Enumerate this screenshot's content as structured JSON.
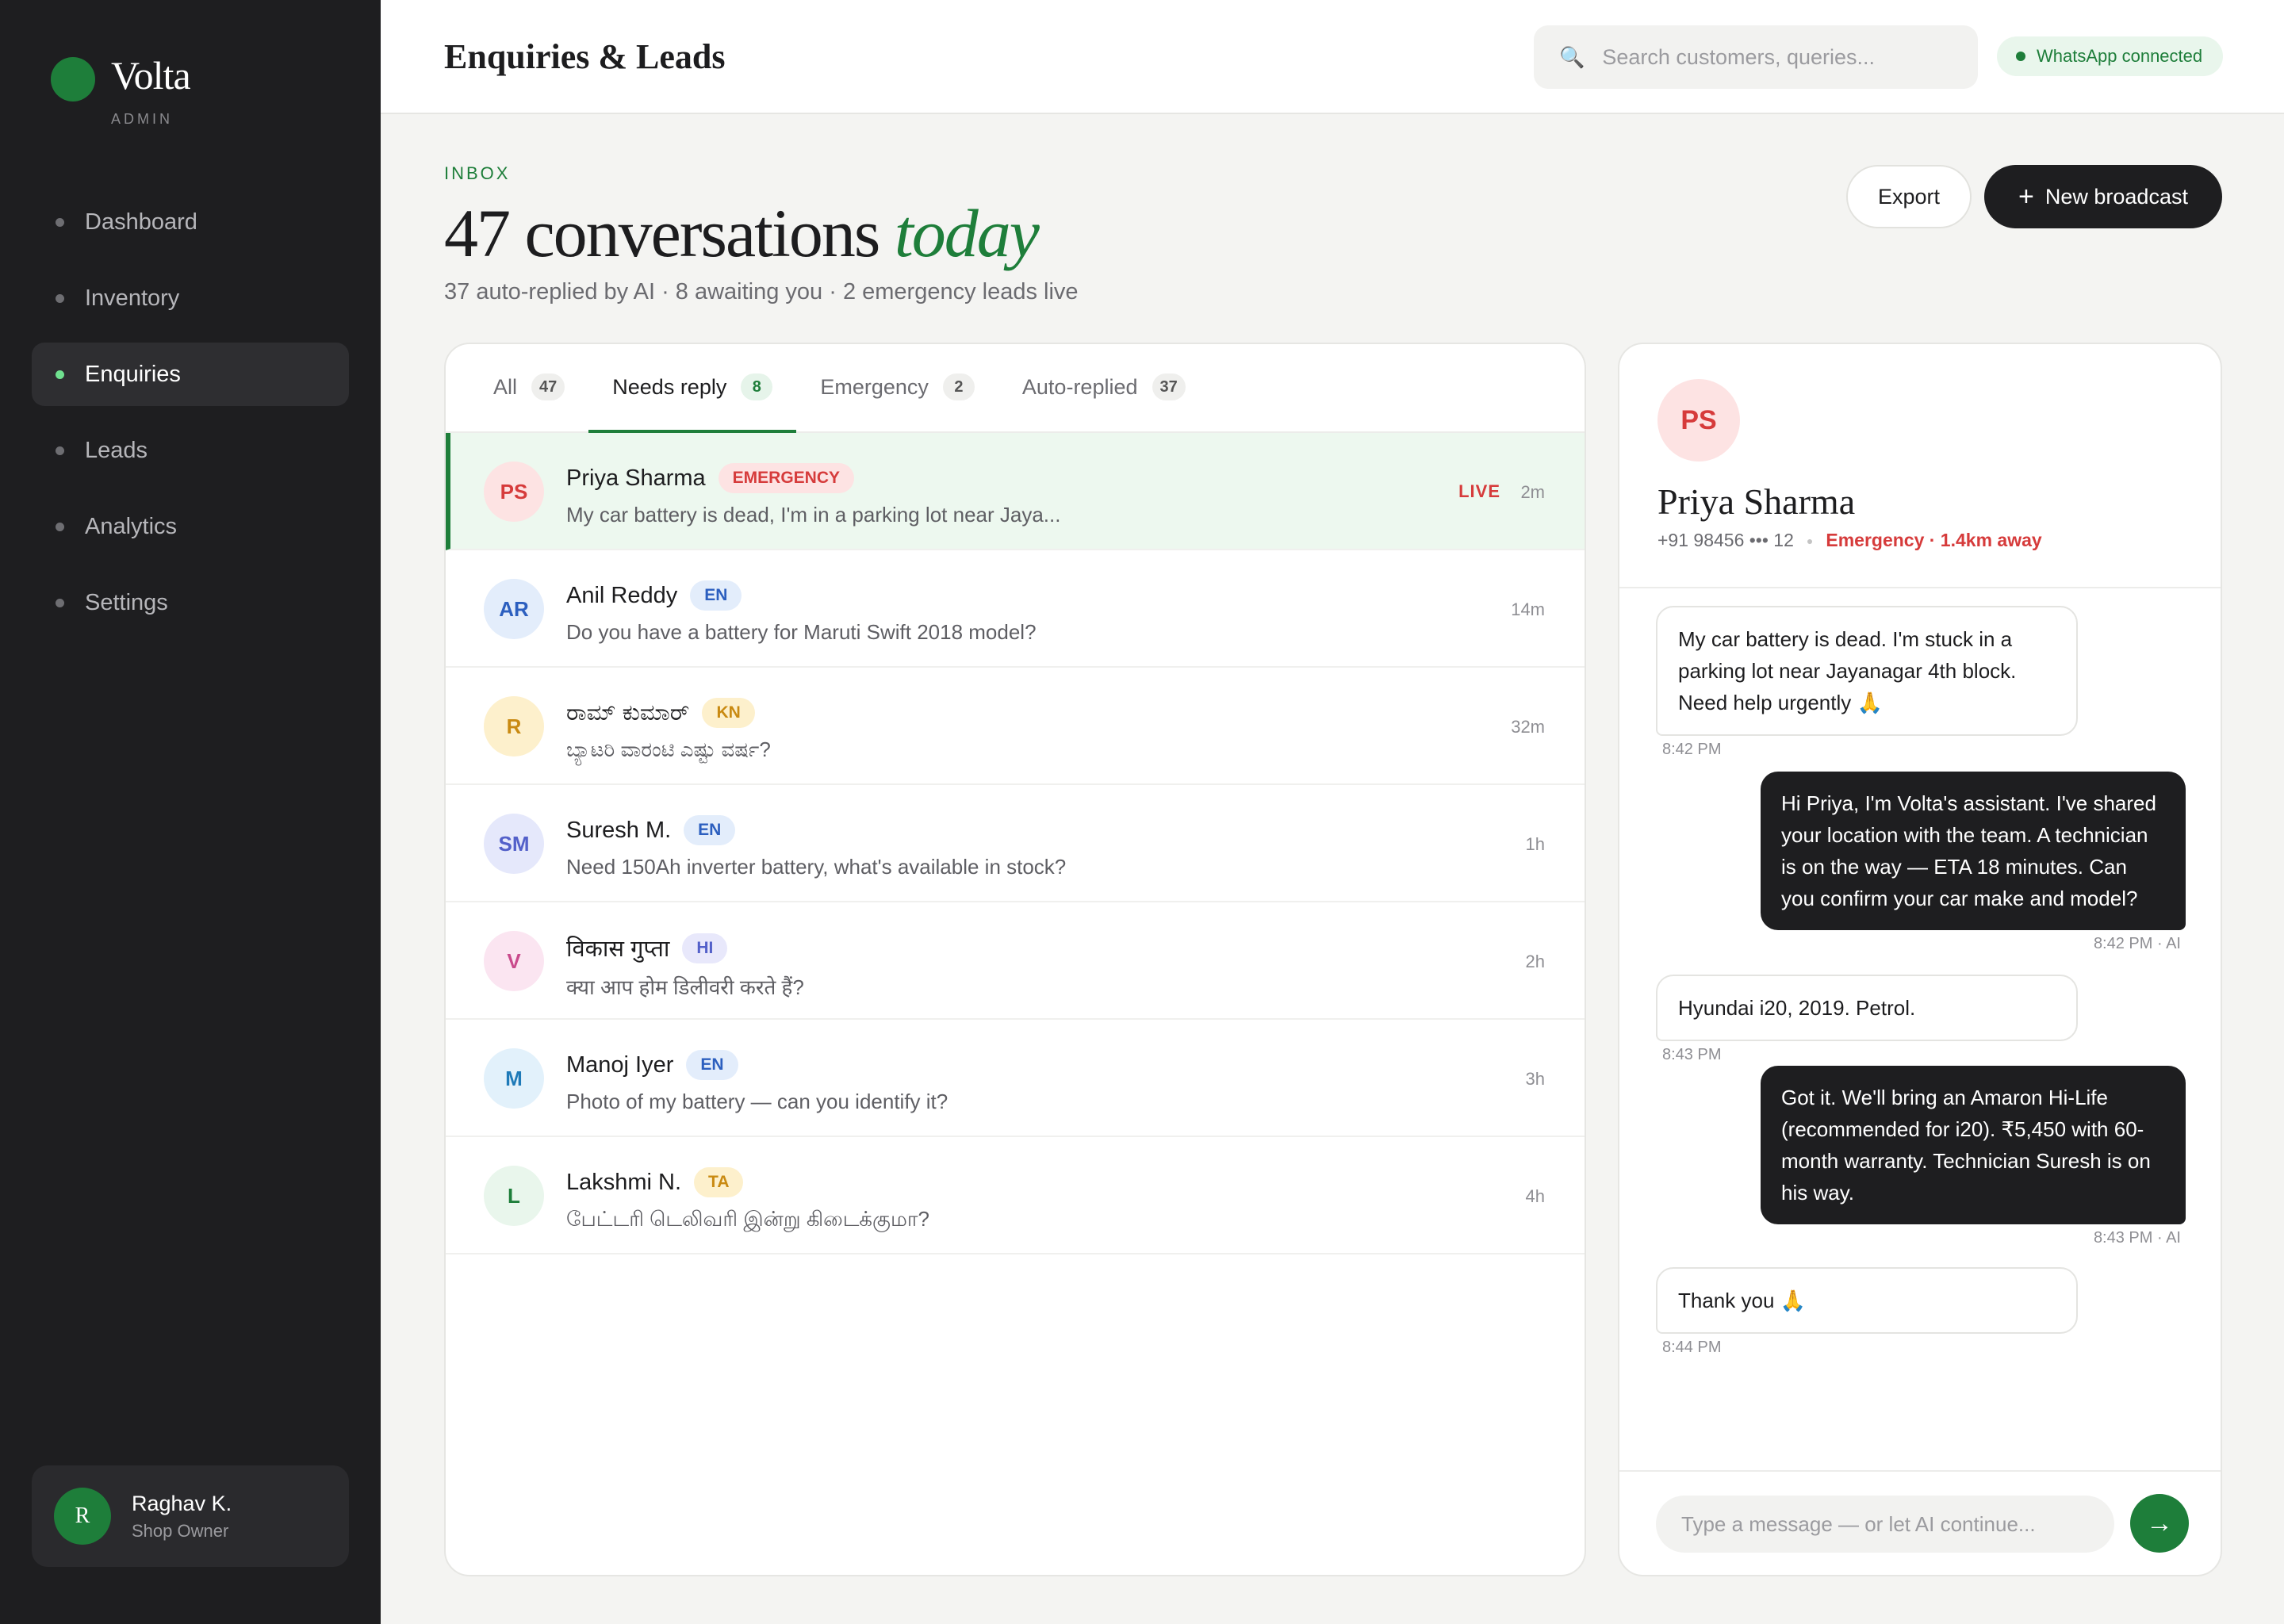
{
  "brand": {
    "name": "Volta",
    "sub": "ADMIN"
  },
  "nav": [
    {
      "label": "Dashboard",
      "active": false
    },
    {
      "label": "Inventory",
      "active": false
    },
    {
      "label": "Enquiries",
      "active": true
    },
    {
      "label": "Leads",
      "active": false
    },
    {
      "label": "Analytics",
      "active": false
    },
    {
      "label": "Settings",
      "active": false
    }
  ],
  "user": {
    "initial": "R",
    "name": "Raghav K.",
    "role": "Shop Owner"
  },
  "header": {
    "title": "Enquiries & Leads",
    "search_placeholder": "Search customers, queries...",
    "status": "WhatsApp connected"
  },
  "inbox": {
    "eyebrow": "INBOX",
    "headline_main": "47 conversations",
    "headline_accent": "today",
    "subline": "37 auto-replied by AI · 8 awaiting you · 2 emergency leads live",
    "export_label": "Export",
    "broadcast_label": "New broadcast"
  },
  "tabs": [
    {
      "label": "All",
      "count": "47",
      "active": false
    },
    {
      "label": "Needs reply",
      "count": "8",
      "active": true
    },
    {
      "label": "Emergency",
      "count": "2",
      "active": false
    },
    {
      "label": "Auto-replied",
      "count": "37",
      "active": false
    }
  ],
  "conversations": [
    {
      "initials": "PS",
      "name": "Priya Sharma",
      "badge": "EMERGENCY",
      "message": "My car battery is dead, I'm in a parking lot near Jaya...",
      "live": "LIVE",
      "time": "2m",
      "avatar_bg": "#fde3e3",
      "avatar_fg": "#d63b3b",
      "badge_bg": "#fde3e3",
      "badge_fg": "#d63b3b",
      "selected": true
    },
    {
      "initials": "AR",
      "name": "Anil Reddy",
      "badge": "EN",
      "message": "Do you have a battery for Maruti Swift 2018 model?",
      "live": "",
      "time": "14m",
      "avatar_bg": "#e3edfb",
      "avatar_fg": "#2c5fbf",
      "badge_bg": "#e3edfb",
      "badge_fg": "#2c5fbf",
      "selected": false
    },
    {
      "initials": "R",
      "name": "ರಾಮ್ ಕುಮಾರ್",
      "badge": "KN",
      "message": "ಬ್ಯಾಟರಿ ವಾರಂಟಿ ಎಷ್ಟು ವರ್ಷ?",
      "live": "",
      "time": "32m",
      "avatar_bg": "#fdf0cc",
      "avatar_fg": "#c98a12",
      "badge_bg": "#fdf0cc",
      "badge_fg": "#c98a12",
      "selected": false
    },
    {
      "initials": "SM",
      "name": "Suresh M.",
      "badge": "EN",
      "message": "Need 150Ah inverter battery, what's available in stock?",
      "live": "",
      "time": "1h",
      "avatar_bg": "#e5e8fb",
      "avatar_fg": "#5360c9",
      "badge_bg": "#e3edfb",
      "badge_fg": "#2c5fbf",
      "selected": false
    },
    {
      "initials": "V",
      "name": "विकास गुप्ता",
      "badge": "HI",
      "message": "क्या आप होम डिलीवरी करते हैं?",
      "live": "",
      "time": "2h",
      "avatar_bg": "#fbe5f1",
      "avatar_fg": "#c94a8c",
      "badge_bg": "#e8e8fb",
      "badge_fg": "#5360c9",
      "selected": false
    },
    {
      "initials": "M",
      "name": "Manoj Iyer",
      "badge": "EN",
      "message": "Photo of my battery — can you identify it?",
      "live": "",
      "time": "3h",
      "avatar_bg": "#e2f1fb",
      "avatar_fg": "#1e7ab8",
      "badge_bg": "#e3edfb",
      "badge_fg": "#2c5fbf",
      "selected": false
    },
    {
      "initials": "L",
      "name": "Lakshmi N.",
      "badge": "TA",
      "message": "பேட்டரி டெலிவரி இன்று கிடைக்குமா?",
      "live": "",
      "time": "4h",
      "avatar_bg": "#e9f6ec",
      "avatar_fg": "#1e7e3a",
      "badge_bg": "#fdf0cc",
      "badge_fg": "#c98a12",
      "selected": false
    }
  ],
  "chat": {
    "initials": "PS",
    "name": "Priya Sharma",
    "phone": "+91 98456 ••• 12",
    "status": "Emergency · 1.4km away",
    "messages": [
      {
        "dir": "in",
        "text": "My car battery is dead. I'm stuck in a parking lot near Jayanagar 4th block. Need help urgently 🙏",
        "time": "8:42 PM"
      },
      {
        "dir": "out",
        "text": "Hi Priya, I'm Volta's assistant. I've shared your location with the team. A technician is on the way — ETA 18 minutes. Can you confirm your car make and model?",
        "time": "8:42 PM · AI"
      },
      {
        "dir": "in",
        "text": "Hyundai i20, 2019. Petrol.",
        "time": "8:43 PM"
      },
      {
        "dir": "out",
        "text": "Got it. We'll bring an Amaron Hi-Life (recommended for i20). ₹5,450 with 60-month warranty. Technician Suresh is on his way.",
        "time": "8:43 PM · AI"
      },
      {
        "dir": "in",
        "text": "Thank you 🙏",
        "time": "8:44 PM"
      }
    ],
    "composer_placeholder": "Type a message — or let AI continue...",
    "send_icon": "→"
  },
  "icons": {
    "search": "search-icon",
    "send": "arrow-right-icon",
    "plus": "plus-icon"
  },
  "colors": {
    "accent": "#1e7e3a",
    "danger": "#d63b3b",
    "sidebar": "#1e1e20"
  }
}
